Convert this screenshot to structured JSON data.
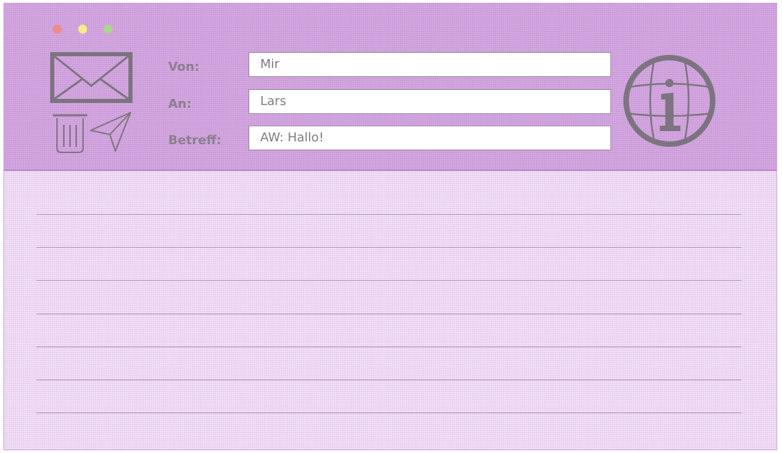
{
  "window": {
    "controls": [
      {
        "name": "close",
        "color": "#f08a86"
      },
      {
        "name": "minimize",
        "color": "#f5ee86"
      },
      {
        "name": "zoom",
        "color": "#a9d68e"
      }
    ]
  },
  "toolbar": {
    "icons": [
      "mail-icon",
      "trash-icon",
      "send-icon",
      "globe-info-icon"
    ]
  },
  "form": {
    "from_label": "Von:",
    "from_value": "Mir",
    "to_label": "An:",
    "to_value": "Lars",
    "subject_label": "Betreff:",
    "subject_value": "AW: Hallo!"
  },
  "message": {
    "body_text": ""
  },
  "colors": {
    "header_bg": "#d4a9e0",
    "body_bg": "#f3e2f7",
    "icon_stroke": "#7c7480",
    "rule_line": "#b68ac6"
  }
}
